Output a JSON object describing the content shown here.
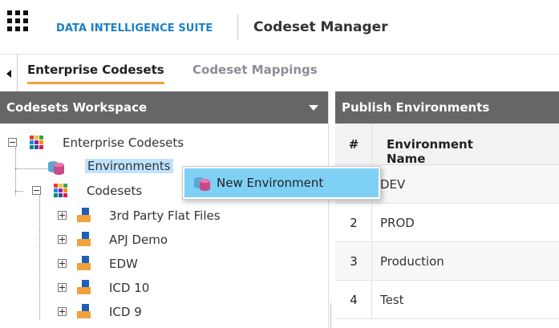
{
  "header": {
    "app_title": "DATA INTELLIGENCE SUITE",
    "module_title": "Codeset Manager"
  },
  "tabs": [
    {
      "label": "Enterprise Codesets",
      "active": true
    },
    {
      "label": "Codeset Mappings",
      "active": false
    }
  ],
  "workspace": {
    "title": "Codesets Workspace",
    "tree": {
      "root": "Enterprise Codesets",
      "environments": "Environments",
      "codesets": "Codesets",
      "children": [
        "3rd Party Flat Files",
        "APJ Demo",
        "EDW",
        "ICD 10",
        "ICD 9"
      ]
    }
  },
  "context_menu": {
    "items": [
      {
        "label": "New Environment",
        "icon": "database-icon"
      }
    ]
  },
  "publish_panel": {
    "title": "Publish Environments",
    "columns": [
      "#",
      "Environment Name"
    ],
    "rows": [
      {
        "num": "",
        "name": "DEV"
      },
      {
        "num": "2",
        "name": "PROD"
      },
      {
        "num": "3",
        "name": "Production"
      },
      {
        "num": "4",
        "name": "Test"
      }
    ]
  },
  "colors": {
    "accent": "#1d7fc4",
    "tab_underline": "#f2a13a",
    "panel_header": "#666666",
    "selection": "#bfe3ff",
    "menu_highlight": "#7fd0f5"
  }
}
